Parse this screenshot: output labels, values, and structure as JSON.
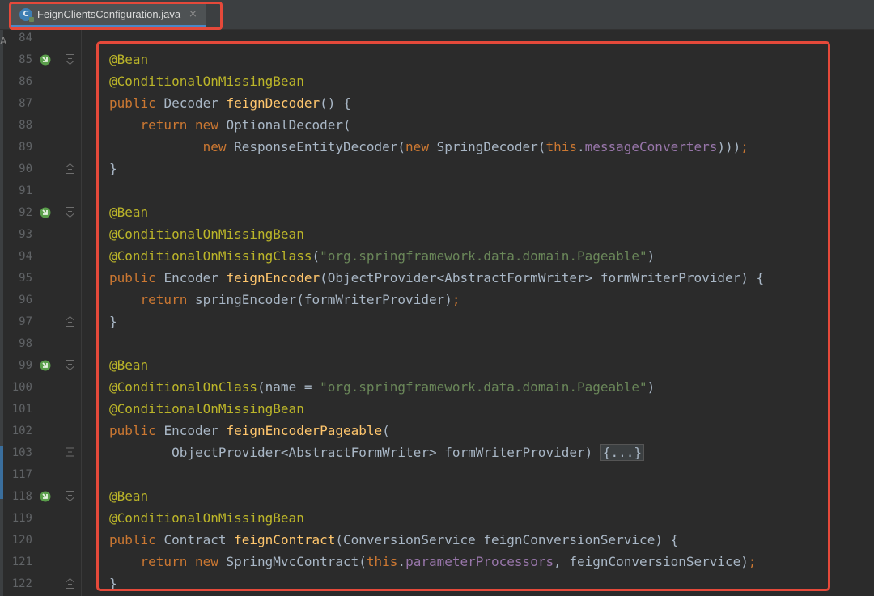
{
  "tab": {
    "filename": "FeignClientsConfiguration.java",
    "icon": "java-class-icon",
    "icon_letter": "C",
    "close": "×"
  },
  "colors": {
    "background": "#2b2b2b",
    "annotation": "#bbb529",
    "keyword": "#cc7832",
    "method": "#ffc66d",
    "string": "#6a8759",
    "field": "#9876aa",
    "highlight": "#e5493a"
  },
  "partial_glyph": "A",
  "lines": [
    {
      "n": "84",
      "bean": false,
      "fold": "none",
      "segs": []
    },
    {
      "n": "85",
      "bean": true,
      "fold": "open",
      "segs": [
        [
          "a",
          "@Bean"
        ]
      ]
    },
    {
      "n": "86",
      "bean": false,
      "fold": "none",
      "segs": [
        [
          "a",
          "@ConditionalOnMissingBean"
        ]
      ]
    },
    {
      "n": "87",
      "bean": false,
      "fold": "none",
      "segs": [
        [
          "k",
          "public "
        ],
        [
          "t",
          "Decoder "
        ],
        [
          "f",
          "feignDecoder"
        ],
        [
          "t",
          "() {"
        ]
      ]
    },
    {
      "n": "88",
      "bean": false,
      "fold": "none",
      "segs": [
        [
          "t",
          "    "
        ],
        [
          "k",
          "return new "
        ],
        [
          "t",
          "OptionalDecoder("
        ]
      ]
    },
    {
      "n": "89",
      "bean": false,
      "fold": "none",
      "segs": [
        [
          "t",
          "            "
        ],
        [
          "k",
          "new "
        ],
        [
          "t",
          "ResponseEntityDecoder("
        ],
        [
          "k",
          "new "
        ],
        [
          "t",
          "SpringDecoder("
        ],
        [
          "k",
          "this"
        ],
        [
          "t",
          "."
        ],
        [
          "p",
          "messageConverters"
        ],
        [
          "t",
          ")))"
        ],
        [
          "k",
          ";"
        ]
      ]
    },
    {
      "n": "90",
      "bean": false,
      "fold": "close",
      "segs": [
        [
          "t",
          "}"
        ]
      ]
    },
    {
      "n": "91",
      "bean": false,
      "fold": "none",
      "segs": []
    },
    {
      "n": "92",
      "bean": true,
      "fold": "open",
      "segs": [
        [
          "a",
          "@Bean"
        ]
      ]
    },
    {
      "n": "93",
      "bean": false,
      "fold": "none",
      "segs": [
        [
          "a",
          "@ConditionalOnMissingBean"
        ]
      ]
    },
    {
      "n": "94",
      "bean": false,
      "fold": "none",
      "segs": [
        [
          "a",
          "@ConditionalOnMissingClass"
        ],
        [
          "t",
          "("
        ],
        [
          "s",
          "\"org.springframework.data.domain.Pageable\""
        ],
        [
          "t",
          ")"
        ]
      ]
    },
    {
      "n": "95",
      "bean": false,
      "fold": "none",
      "segs": [
        [
          "k",
          "public "
        ],
        [
          "t",
          "Encoder "
        ],
        [
          "f",
          "feignEncoder"
        ],
        [
          "t",
          "(ObjectProvider<AbstractFormWriter> formWriterProvider) {"
        ]
      ]
    },
    {
      "n": "96",
      "bean": false,
      "fold": "none",
      "segs": [
        [
          "t",
          "    "
        ],
        [
          "k",
          "return "
        ],
        [
          "t",
          "springEncoder(formWriterProvider)"
        ],
        [
          "k",
          ";"
        ]
      ]
    },
    {
      "n": "97",
      "bean": false,
      "fold": "close",
      "segs": [
        [
          "t",
          "}"
        ]
      ]
    },
    {
      "n": "98",
      "bean": false,
      "fold": "none",
      "segs": []
    },
    {
      "n": "99",
      "bean": true,
      "fold": "open",
      "segs": [
        [
          "a",
          "@Bean"
        ]
      ]
    },
    {
      "n": "100",
      "bean": false,
      "fold": "none",
      "segs": [
        [
          "a",
          "@ConditionalOnClass"
        ],
        [
          "t",
          "(name = "
        ],
        [
          "s",
          "\"org.springframework.data.domain.Pageable\""
        ],
        [
          "t",
          ")"
        ]
      ]
    },
    {
      "n": "101",
      "bean": false,
      "fold": "none",
      "segs": [
        [
          "a",
          "@ConditionalOnMissingBean"
        ]
      ]
    },
    {
      "n": "102",
      "bean": false,
      "fold": "none",
      "segs": [
        [
          "k",
          "public "
        ],
        [
          "t",
          "Encoder "
        ],
        [
          "f",
          "feignEncoderPageable"
        ],
        [
          "t",
          "("
        ]
      ]
    },
    {
      "n": "103",
      "bean": false,
      "fold": "collapsed",
      "segs": [
        [
          "t",
          "        ObjectProvider<AbstractFormWriter> formWriterProvider) "
        ],
        [
          "fold",
          "{...}"
        ]
      ]
    },
    {
      "n": "117",
      "bean": false,
      "fold": "none",
      "segs": []
    },
    {
      "n": "118",
      "bean": true,
      "fold": "open",
      "segs": [
        [
          "a",
          "@Bean"
        ]
      ]
    },
    {
      "n": "119",
      "bean": false,
      "fold": "none",
      "segs": [
        [
          "a",
          "@ConditionalOnMissingBean"
        ]
      ]
    },
    {
      "n": "120",
      "bean": false,
      "fold": "none",
      "segs": [
        [
          "k",
          "public "
        ],
        [
          "t",
          "Contract "
        ],
        [
          "f",
          "feignContract"
        ],
        [
          "t",
          "(ConversionService feignConversionService) {"
        ]
      ]
    },
    {
      "n": "121",
      "bean": false,
      "fold": "none",
      "segs": [
        [
          "t",
          "    "
        ],
        [
          "k",
          "return new "
        ],
        [
          "t",
          "SpringMvcContract("
        ],
        [
          "k",
          "this"
        ],
        [
          "t",
          "."
        ],
        [
          "p",
          "parameterProcessors"
        ],
        [
          "t",
          ", feignConversionService)"
        ],
        [
          "k",
          ";"
        ]
      ]
    },
    {
      "n": "122",
      "bean": false,
      "fold": "close",
      "segs": [
        [
          "t",
          "}"
        ]
      ]
    }
  ]
}
